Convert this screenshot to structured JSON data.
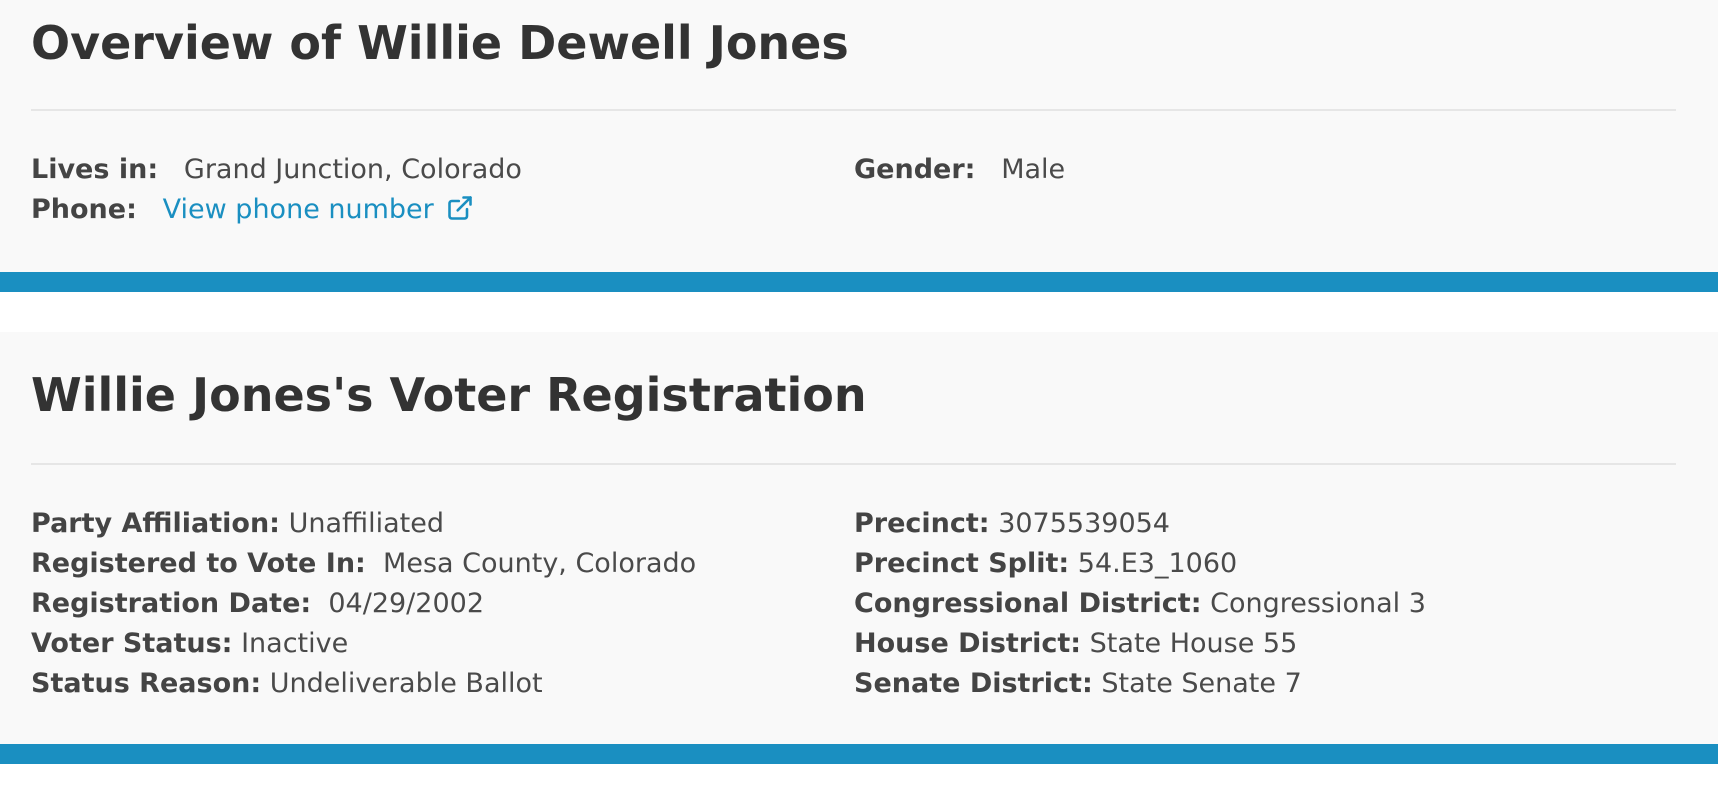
{
  "overview": {
    "title": "Overview of Willie Dewell Jones",
    "lives_in_label": "Lives in:",
    "lives_in_value": "Grand Junction, Colorado",
    "phone_label": "Phone:",
    "phone_link": "View phone number",
    "gender_label": "Gender:",
    "gender_value": "Male"
  },
  "registration": {
    "title": "Willie Jones's Voter Registration",
    "left": [
      {
        "label": "Party Affiliation:",
        "value": "Unaffiliated"
      },
      {
        "label": "Registered to Vote In:",
        "value": "Mesa County, Colorado"
      },
      {
        "label": "Registration Date:",
        "value": "04/29/2002"
      },
      {
        "label": "Voter Status:",
        "value": "Inactive"
      },
      {
        "label": "Status Reason:",
        "value": "Undeliverable Ballot"
      }
    ],
    "right": [
      {
        "label": "Precinct:",
        "value": "3075539054"
      },
      {
        "label": "Precinct Split:",
        "value": "54.E3_1060"
      },
      {
        "label": "Congressional District:",
        "value": "Congressional 3"
      },
      {
        "label": "House District:",
        "value": "State House 55"
      },
      {
        "label": "Senate District:",
        "value": "State Senate 7"
      }
    ]
  },
  "icons": {
    "external_link": "external-link-icon"
  },
  "colors": {
    "accent": "#1a8fc1",
    "card_bg": "#f9f9f9",
    "text": "#333333"
  }
}
